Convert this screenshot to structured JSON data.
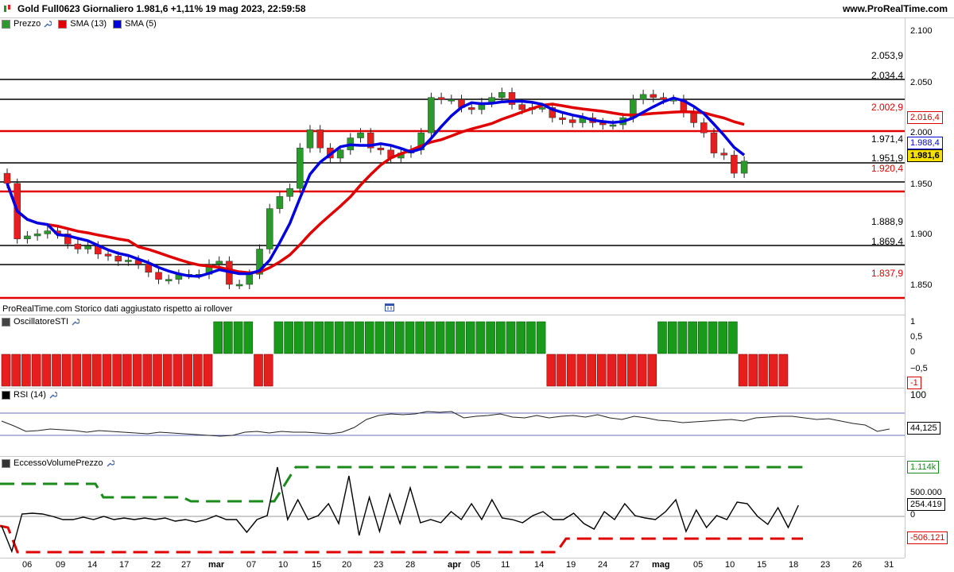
{
  "header": {
    "title": "Gold Full0623 Giornaliero 1.981,6 +1,11% 19 mag 2023, 22:59:58",
    "brand": "www.ProRealTime.com"
  },
  "price_panel": {
    "legend": [
      {
        "label": "Prezzo",
        "color": "#2a9a2a"
      },
      {
        "label": "SMA (13)",
        "color": "#e00000"
      },
      {
        "label": "SMA (5)",
        "color": "#0000e0"
      }
    ],
    "axis_ticks": [
      "2.100",
      "2.050",
      "2.000",
      "1.950",
      "1.900",
      "1.850"
    ],
    "levels": [
      {
        "value": "2.053,9",
        "color": "#000000"
      },
      {
        "value": "2.034,4",
        "color": "#000000"
      },
      {
        "value": "2.002,9",
        "color": "#e00000"
      },
      {
        "value": "1.971,4",
        "color": "#000000"
      },
      {
        "value": "1.951,9",
        "color": "#000000"
      },
      {
        "value": "1.920,4",
        "color": "#e00000"
      },
      {
        "value": "1.888,9",
        "color": "#000000"
      },
      {
        "value": "1.869,4",
        "color": "#000000"
      },
      {
        "value": "1.837,9",
        "color": "#e00000"
      }
    ],
    "tags": [
      {
        "value": "2.016,4",
        "color": "#e00000"
      },
      {
        "value": "1.988,4",
        "color": "#0000e0"
      },
      {
        "value": "1.981,6",
        "color": "#000000"
      }
    ],
    "note": "ProRealTime.com Storico dati aggiustato rispetto ai rollover"
  },
  "sti_panel": {
    "label": "OscillatoreSTI",
    "axis_ticks": [
      "1",
      "0,5",
      "0",
      "−0,5",
      "-1"
    ],
    "colors": {
      "up": "#1a9a1a",
      "down": "#e61e1e"
    }
  },
  "rsi_panel": {
    "label": "RSI (14)",
    "axis_ticks": [
      "100"
    ],
    "value_tag": "44,125"
  },
  "volume_panel": {
    "label": "EccessoVolumePrezzo",
    "axis_ticks": [
      "500.000",
      "0"
    ],
    "tags": [
      {
        "value": "1.114k",
        "color": "#1a8a1a"
      },
      {
        "value": "254.419",
        "color": "#000000"
      },
      {
        "value": "-506.121",
        "color": "#e00000"
      }
    ]
  },
  "x_axis": {
    "labels": [
      "06",
      "09",
      "14",
      "17",
      "22",
      "27",
      "mar",
      "07",
      "10",
      "15",
      "20",
      "23",
      "28",
      "apr",
      "05",
      "11",
      "14",
      "19",
      "24",
      "27",
      "mag",
      "05",
      "10",
      "15",
      "18",
      "23",
      "26",
      "31"
    ]
  }
}
